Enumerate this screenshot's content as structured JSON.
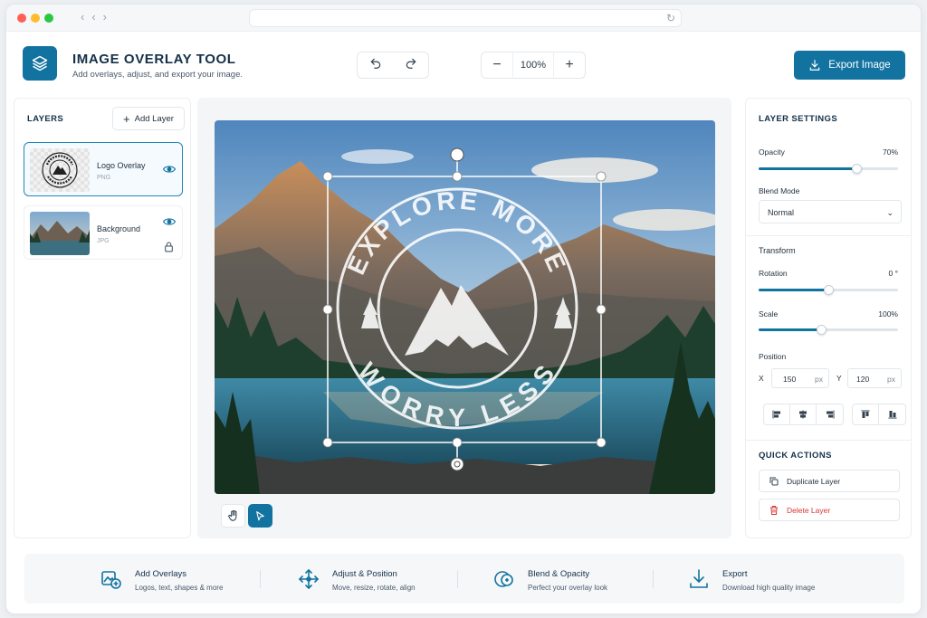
{
  "app": {
    "title": "IMAGE OVERLAY TOOL",
    "subtitle": "Add overlays, adjust, and export your image.",
    "export_label": "Export Image",
    "accent_color": "#1273a0",
    "danger_color": "#d93636"
  },
  "toolbar": {
    "zoom": "100%",
    "zoom_out_icon": "minus-icon",
    "zoom_in_icon": "plus-icon"
  },
  "layers_panel": {
    "title": "LAYERS",
    "add_label": "Add Layer",
    "items": [
      {
        "name": "Logo Overlay",
        "type": "PNG",
        "selected": true
      },
      {
        "name": "Background",
        "type": "JPG",
        "locked": true
      }
    ]
  },
  "overlay": {
    "top_text": "EXPLORE MORE",
    "bottom_text": "WORRY LESS"
  },
  "settings": {
    "title": "LAYER SETTINGS",
    "opacity_label": "Opacity",
    "opacity_value": "70%",
    "opacity_fraction": 0.7,
    "blend_label": "Blend Mode",
    "blend_value": "Normal",
    "transform_title": "Transform",
    "rotation_label": "Rotation",
    "rotation_value": "0 °",
    "rotation_fraction": 0.5,
    "scale_label": "Scale",
    "scale_value": "100%",
    "scale_fraction": 0.45,
    "position_label": "Position",
    "x_label": "X",
    "x_value": "150",
    "y_label": "Y",
    "y_value": "120",
    "unit": "px"
  },
  "quick_actions": {
    "title": "QUICK ACTIONS",
    "duplicate_label": "Duplicate Layer",
    "delete_label": "Delete Layer"
  },
  "features": [
    {
      "title": "Add Overlays",
      "desc": "Logos, text, shapes & more",
      "icon": "add-overlay-icon"
    },
    {
      "title": "Adjust & Position",
      "desc": "Move, resize, rotate, align",
      "icon": "move-arrows-icon"
    },
    {
      "title": "Blend & Opacity",
      "desc": "Perfect your overlay look",
      "icon": "blend-icon"
    },
    {
      "title": "Export",
      "desc": "Download high quality image",
      "icon": "download-icon"
    }
  ]
}
